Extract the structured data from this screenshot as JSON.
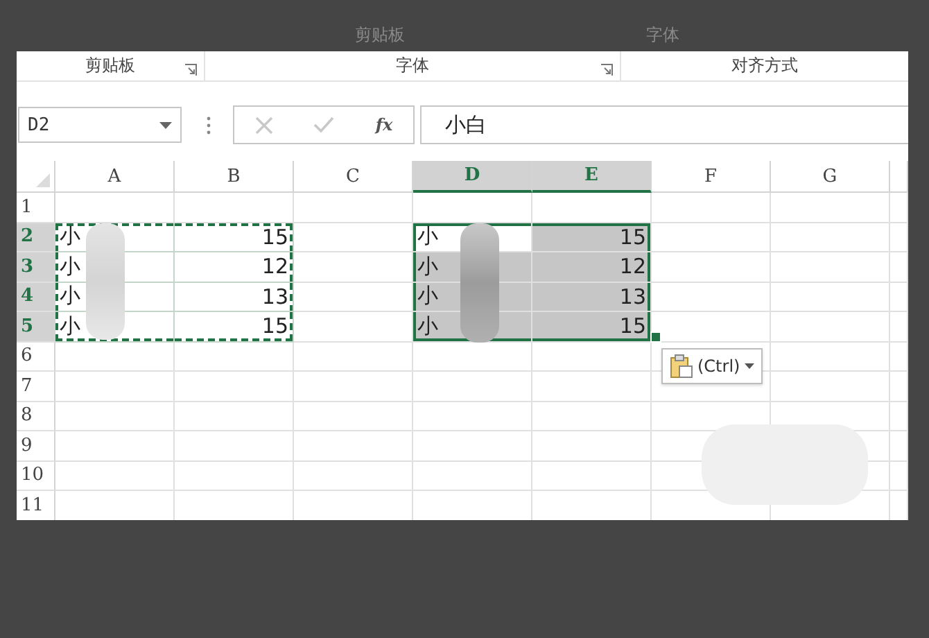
{
  "background": {
    "ribbon_groups": [
      "剪贴板",
      "字体"
    ]
  },
  "ribbon": {
    "groups": [
      {
        "label": "剪贴板",
        "launcher": true
      },
      {
        "label": "字体",
        "launcher": true
      },
      {
        "label": "对齐方式",
        "launcher": false
      }
    ]
  },
  "formula_bar": {
    "name_box": "D2",
    "function_label": "fx",
    "value": "小白"
  },
  "sheet": {
    "columns": [
      {
        "label": "A",
        "selected": false
      },
      {
        "label": "B",
        "selected": false
      },
      {
        "label": "C",
        "selected": false
      },
      {
        "label": "D",
        "selected": true
      },
      {
        "label": "E",
        "selected": true
      },
      {
        "label": "F",
        "selected": false
      },
      {
        "label": "G",
        "selected": false
      }
    ],
    "rows": [
      {
        "label": "1",
        "selected": false,
        "cells": [
          {
            "text": "",
            "selected": false,
            "copied": false
          },
          {
            "text": "",
            "selected": false,
            "copied": false
          },
          {
            "text": "",
            "selected": false,
            "copied": false
          },
          {
            "text": "",
            "selected": false,
            "copied": false
          },
          {
            "text": "",
            "selected": false,
            "copied": false
          },
          {
            "text": "",
            "selected": false,
            "copied": false
          },
          {
            "text": "",
            "selected": false,
            "copied": false
          }
        ]
      },
      {
        "label": "2",
        "selected": true,
        "cells": [
          {
            "text": "小",
            "selected": false,
            "copied": true
          },
          {
            "text": "15",
            "selected": false,
            "copied": true
          },
          {
            "text": "",
            "selected": false,
            "copied": false
          },
          {
            "text": "小",
            "selected": true,
            "copied": false
          },
          {
            "text": "15",
            "selected": true,
            "copied": false
          },
          {
            "text": "",
            "selected": false,
            "copied": false
          },
          {
            "text": "",
            "selected": false,
            "copied": false
          }
        ]
      },
      {
        "label": "3",
        "selected": true,
        "cells": [
          {
            "text": "小",
            "selected": false,
            "copied": true
          },
          {
            "text": "12",
            "selected": false,
            "copied": true
          },
          {
            "text": "",
            "selected": false,
            "copied": false
          },
          {
            "text": "小",
            "selected": true,
            "copied": false
          },
          {
            "text": "12",
            "selected": true,
            "copied": false
          },
          {
            "text": "",
            "selected": false,
            "copied": false
          },
          {
            "text": "",
            "selected": false,
            "copied": false
          }
        ]
      },
      {
        "label": "4",
        "selected": true,
        "cells": [
          {
            "text": "小",
            "selected": false,
            "copied": true
          },
          {
            "text": "13",
            "selected": false,
            "copied": true
          },
          {
            "text": "",
            "selected": false,
            "copied": false
          },
          {
            "text": "小",
            "selected": true,
            "copied": false
          },
          {
            "text": "13",
            "selected": true,
            "copied": false
          },
          {
            "text": "",
            "selected": false,
            "copied": false
          },
          {
            "text": "",
            "selected": false,
            "copied": false
          }
        ]
      },
      {
        "label": "5",
        "selected": true,
        "cells": [
          {
            "text": "小",
            "selected": false,
            "copied": true
          },
          {
            "text": "15",
            "selected": false,
            "copied": true
          },
          {
            "text": "",
            "selected": false,
            "copied": false
          },
          {
            "text": "小",
            "selected": true,
            "copied": false
          },
          {
            "text": "15",
            "selected": true,
            "copied": false
          },
          {
            "text": "",
            "selected": false,
            "copied": false
          },
          {
            "text": "",
            "selected": false,
            "copied": false
          }
        ]
      },
      {
        "label": "6",
        "selected": false,
        "cells": [
          {
            "text": "",
            "selected": false,
            "copied": false
          },
          {
            "text": "",
            "selected": false,
            "copied": false
          },
          {
            "text": "",
            "selected": false,
            "copied": false
          },
          {
            "text": "",
            "selected": false,
            "copied": false
          },
          {
            "text": "",
            "selected": false,
            "copied": false
          },
          {
            "text": "",
            "selected": false,
            "copied": false
          },
          {
            "text": "",
            "selected": false,
            "copied": false
          }
        ]
      },
      {
        "label": "7",
        "selected": false,
        "cells": [
          {
            "text": "",
            "selected": false,
            "copied": false
          },
          {
            "text": "",
            "selected": false,
            "copied": false
          },
          {
            "text": "",
            "selected": false,
            "copied": false
          },
          {
            "text": "",
            "selected": false,
            "copied": false
          },
          {
            "text": "",
            "selected": false,
            "copied": false
          },
          {
            "text": "",
            "selected": false,
            "copied": false
          },
          {
            "text": "",
            "selected": false,
            "copied": false
          }
        ]
      },
      {
        "label": "8",
        "selected": false,
        "cells": [
          {
            "text": "",
            "selected": false,
            "copied": false
          },
          {
            "text": "",
            "selected": false,
            "copied": false
          },
          {
            "text": "",
            "selected": false,
            "copied": false
          },
          {
            "text": "",
            "selected": false,
            "copied": false
          },
          {
            "text": "",
            "selected": false,
            "copied": false
          },
          {
            "text": "",
            "selected": false,
            "copied": false
          },
          {
            "text": "",
            "selected": false,
            "copied": false
          }
        ]
      },
      {
        "label": "9",
        "selected": false,
        "cells": [
          {
            "text": "",
            "selected": false,
            "copied": false
          },
          {
            "text": "",
            "selected": false,
            "copied": false
          },
          {
            "text": "",
            "selected": false,
            "copied": false
          },
          {
            "text": "",
            "selected": false,
            "copied": false
          },
          {
            "text": "",
            "selected": false,
            "copied": false
          },
          {
            "text": "",
            "selected": false,
            "copied": false
          },
          {
            "text": "",
            "selected": false,
            "copied": false
          }
        ]
      },
      {
        "label": "10",
        "selected": false,
        "cells": [
          {
            "text": "",
            "selected": false,
            "copied": false
          },
          {
            "text": "",
            "selected": false,
            "copied": false
          },
          {
            "text": "",
            "selected": false,
            "copied": false
          },
          {
            "text": "",
            "selected": false,
            "copied": false
          },
          {
            "text": "",
            "selected": false,
            "copied": false
          },
          {
            "text": "",
            "selected": false,
            "copied": false
          },
          {
            "text": "",
            "selected": false,
            "copied": false
          }
        ]
      },
      {
        "label": "11",
        "selected": false,
        "cells": [
          {
            "text": "",
            "selected": false,
            "copied": false
          },
          {
            "text": "",
            "selected": false,
            "copied": false
          },
          {
            "text": "",
            "selected": false,
            "copied": false
          },
          {
            "text": "",
            "selected": false,
            "copied": false
          },
          {
            "text": "",
            "selected": false,
            "copied": false
          },
          {
            "text": "",
            "selected": false,
            "copied": false
          },
          {
            "text": "",
            "selected": false,
            "copied": false
          }
        ]
      }
    ]
  },
  "paste_options": {
    "label": "(Ctrl)"
  }
}
